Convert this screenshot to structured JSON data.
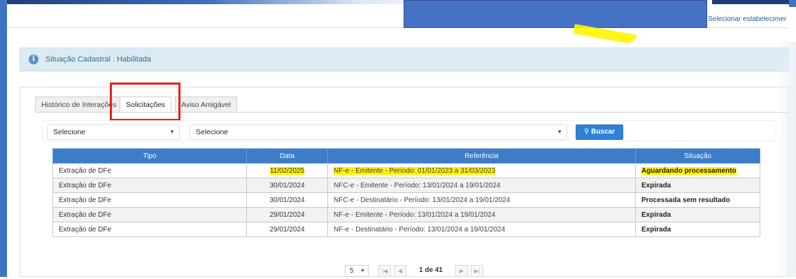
{
  "header": {
    "select_establishment_link": "Selecionar estabelecimen"
  },
  "info_bar": {
    "icon": "info-icon",
    "text": "Situação Cadastral : Habilitada"
  },
  "tabs": [
    {
      "label": "Histórico de Interações",
      "active": false
    },
    {
      "label": "Solicitações",
      "active": true
    },
    {
      "label": "Aviso Amigável",
      "active": false
    }
  ],
  "filters": {
    "select_1": "Selecione",
    "select_2": "Selecione",
    "search_button": "Buscar",
    "search_icon": "search-icon"
  },
  "table": {
    "headers": [
      "Tipo",
      "Data",
      "Referência",
      "Situação"
    ],
    "rows": [
      {
        "tipo": "Extração de DFe",
        "data": "11/02/2025",
        "referencia": "NF-e - Emitente - Período: 01/01/2023 a 31/03/2023",
        "situacao": "Aguardando processamento"
      },
      {
        "tipo": "Extração de DFe",
        "data": "30/01/2024",
        "referencia": "NFC-e - Emitente - Período: 13/01/2024 a 19/01/2024",
        "situacao": "Expirada"
      },
      {
        "tipo": "Extração de DFe",
        "data": "30/01/2024",
        "referencia": "NFC-e - Destinatário - Período: 13/01/2024 a 19/01/2024",
        "situacao": "Processada sem resultado"
      },
      {
        "tipo": "Extração de DFe",
        "data": "29/01/2024",
        "referencia": "NF-e - Emitente - Período: 13/01/2024 a 19/01/2024",
        "situacao": "Expirada"
      },
      {
        "tipo": "Extração de DFe",
        "data": "29/01/2024",
        "referencia": "NF-e - Destinatário - Período: 13/01/2024 a 19/01/2024",
        "situacao": "Expirada"
      }
    ]
  },
  "pager": {
    "page_size": "5",
    "page_text": "1 de 41",
    "first_icon": "first-page-icon",
    "prev_icon": "prev-page-icon",
    "next_icon": "next-page-icon",
    "last_icon": "last-page-icon"
  },
  "colors": {
    "frame_blue": "#3f73c4",
    "redaction_blue": "#4472c4",
    "header_row_blue": "#3d7cc7",
    "button_blue": "#2f82d6",
    "highlight_yellow": "#fff200",
    "annotation_red": "#ee1c1c"
  }
}
